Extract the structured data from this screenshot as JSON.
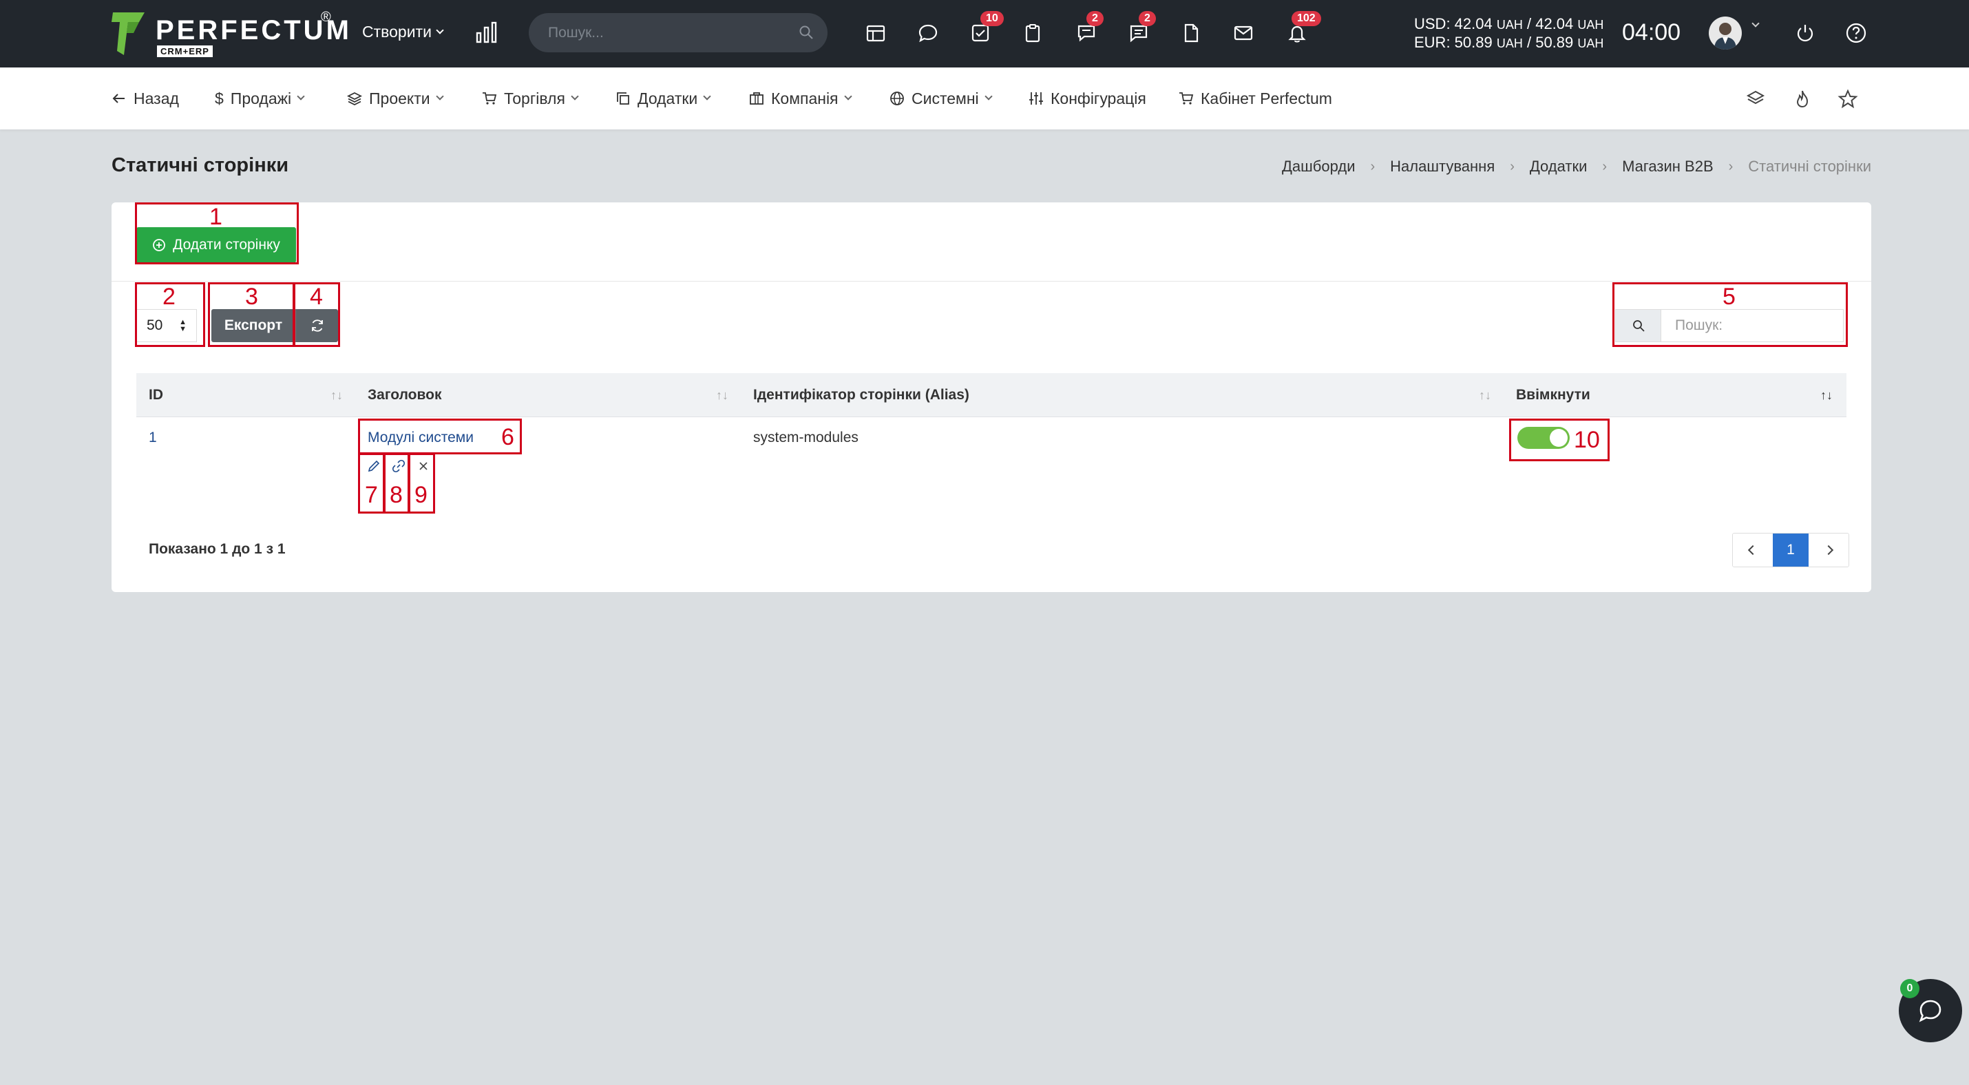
{
  "brand": {
    "name": "PERFECTUM",
    "registered": "®",
    "sub": "CRM+ERP",
    "accent": "#6fbe44"
  },
  "topbar": {
    "create_label": "Створити",
    "search_placeholder": "Пошук...",
    "badges": {
      "tasks": "10",
      "chat": "2",
      "messages": "2",
      "notifications": "102"
    },
    "usd_label": "USD: 42.04",
    "usd_unit1": "UAH",
    "usd_mid": " / 42.04 ",
    "usd_unit2": "UAH",
    "eur_label": "EUR: 50.89",
    "eur_unit1": "UAH",
    "eur_mid": " / 50.89 ",
    "eur_unit2": "UAH",
    "time": "04:00"
  },
  "nav": {
    "back": "Назад",
    "sales": "Продажі",
    "projects": "Проекти",
    "trade": "Торгівля",
    "addons": "Додатки",
    "company": "Компанія",
    "system": "Системні",
    "config": "Конфігурація",
    "cabinet": "Кабінет Perfectum"
  },
  "page": {
    "title": "Статичні сторінки",
    "breadcrumb": [
      "Дашборди",
      "Налаштування",
      "Додатки",
      "Магазин B2B",
      "Статичні сторінки"
    ]
  },
  "toolbar": {
    "add_label": "Додати сторінку",
    "page_length": "50",
    "export_label": "Експорт",
    "search_placeholder": "Пошук:"
  },
  "table": {
    "headers": [
      "ID",
      "Заголовок",
      "Ідентифікатор сторінки (Alias)",
      "Ввімкнути"
    ],
    "rows": [
      {
        "id": "1",
        "title": "Модулі системи",
        "alias": "system-modules",
        "enabled": true
      }
    ],
    "info": "Показано 1 до 1 з 1",
    "current_page": "1"
  },
  "annotations": [
    "1",
    "2",
    "3",
    "4",
    "5",
    "6",
    "7",
    "8",
    "9",
    "10"
  ],
  "chat": {
    "badge": "0"
  },
  "colors": {
    "topbar": "#22272d",
    "green": "#28a745",
    "primary": "#2b73d1",
    "annotation": "#d0021b"
  }
}
